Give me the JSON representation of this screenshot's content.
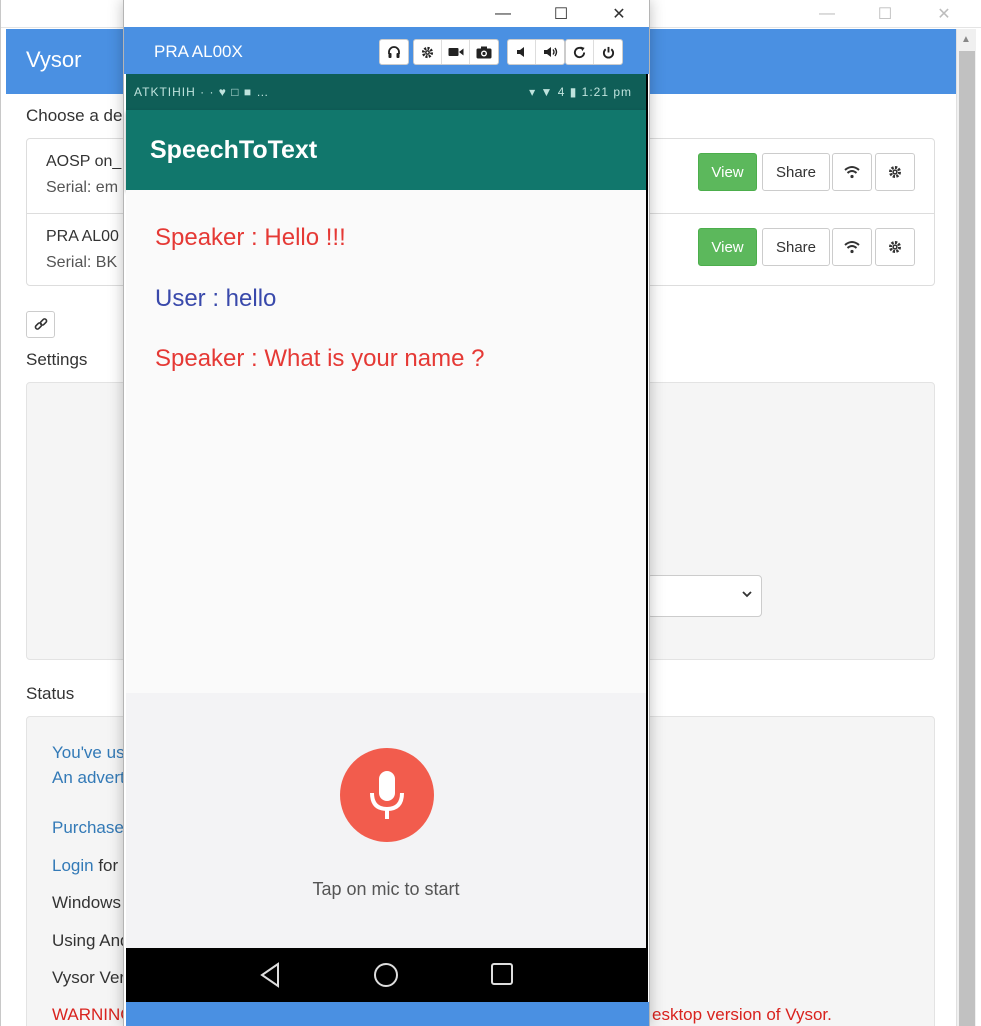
{
  "main": {
    "app_title": "Vysor",
    "choose_label": "Choose a de",
    "devices": [
      {
        "name": "AOSP on_",
        "serial": "Serial: em",
        "view_label": "View",
        "share_label": "Share"
      },
      {
        "name": "PRA AL00",
        "serial": "Serial: BK",
        "view_label": "View",
        "share_label": "Share"
      }
    ],
    "settings_label": "Settings",
    "status_label": "Status",
    "status_lines": [
      {
        "text": "You've us",
        "style": "blue"
      },
      {
        "text": "An advert",
        "style": "blue"
      },
      {
        "text": "Purchase",
        "style": "blue"
      },
      {
        "text": "Login",
        "style": "blue",
        "suffix": " for"
      },
      {
        "text": "Windows",
        "style": "dark"
      },
      {
        "text": "Using And",
        "style": "dark"
      },
      {
        "text": "Vysor Ver",
        "style": "dark"
      },
      {
        "text": "WARNING",
        "style": "red"
      }
    ],
    "warning_tail": "esktop version of Vysor."
  },
  "device_window": {
    "name": "PRA AL00X",
    "toolbar_icons": [
      "headphones-icon",
      "gear-icon",
      "video-icon",
      "camera-icon",
      "volume-down-icon",
      "volume-up-icon",
      "rotate-icon",
      "power-icon"
    ]
  },
  "phone": {
    "status_left": "ATKTIHIH · · ♥ □ ■ …",
    "status_right": "▾ ▼ 4 ▮ 1:21 pm",
    "app_title": "SpeechToText",
    "messages": [
      {
        "text": "Speaker : Hello !!!",
        "who": "speaker"
      },
      {
        "text": "User : hello",
        "who": "user"
      },
      {
        "text": "Speaker : What is your name ?",
        "who": "speaker"
      }
    ],
    "hint": "Tap on mic to start"
  },
  "colors": {
    "header_blue": "#4a90e2",
    "view_green": "#5cb85c",
    "appbar_teal": "#11776c",
    "mic_red": "#f25c4d",
    "speaker_red": "#e53935",
    "user_blue": "#3949ab"
  }
}
